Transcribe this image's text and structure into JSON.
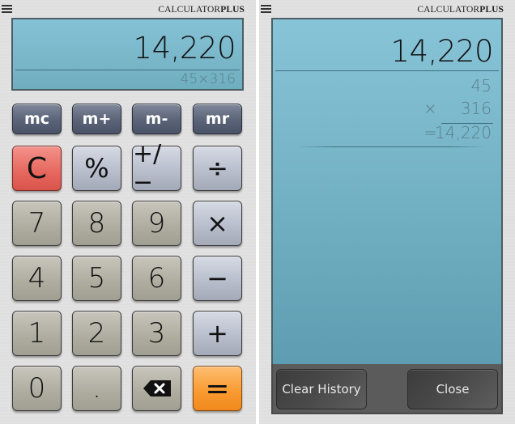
{
  "brand": {
    "prefix": "CALCULATOR",
    "suffix": "PLUS"
  },
  "calculator": {
    "display": {
      "value": "14,220",
      "expression": "45×316"
    },
    "memory_row": [
      {
        "label": "mc",
        "name": "memory-clear-button"
      },
      {
        "label": "m+",
        "name": "memory-add-button"
      },
      {
        "label": "m-",
        "name": "memory-subtract-button"
      },
      {
        "label": "mr",
        "name": "memory-recall-button"
      }
    ],
    "keys": {
      "clear": "C",
      "percent": "%",
      "sign": "+/−",
      "divide": "÷",
      "seven": "7",
      "eight": "8",
      "nine": "9",
      "multiply": "×",
      "four": "4",
      "five": "5",
      "six": "6",
      "minus": "−",
      "one": "1",
      "two": "2",
      "three": "3",
      "plus": "+",
      "zero": "0",
      "decimal": ".",
      "backspace": "backspace-icon",
      "equals": "="
    }
  },
  "history": {
    "display_value": "14,220",
    "entry": {
      "operand1": "45",
      "operator": "×",
      "operand2": "316",
      "equals_sign": "=",
      "result": "14,220"
    },
    "buttons": {
      "clear_history": "Clear History",
      "close": "Close"
    }
  },
  "colors": {
    "display_bg": "#7dbacd",
    "clear_key": "#e5675e",
    "equals_key": "#f8992f",
    "memory_key": "#5a6377"
  }
}
